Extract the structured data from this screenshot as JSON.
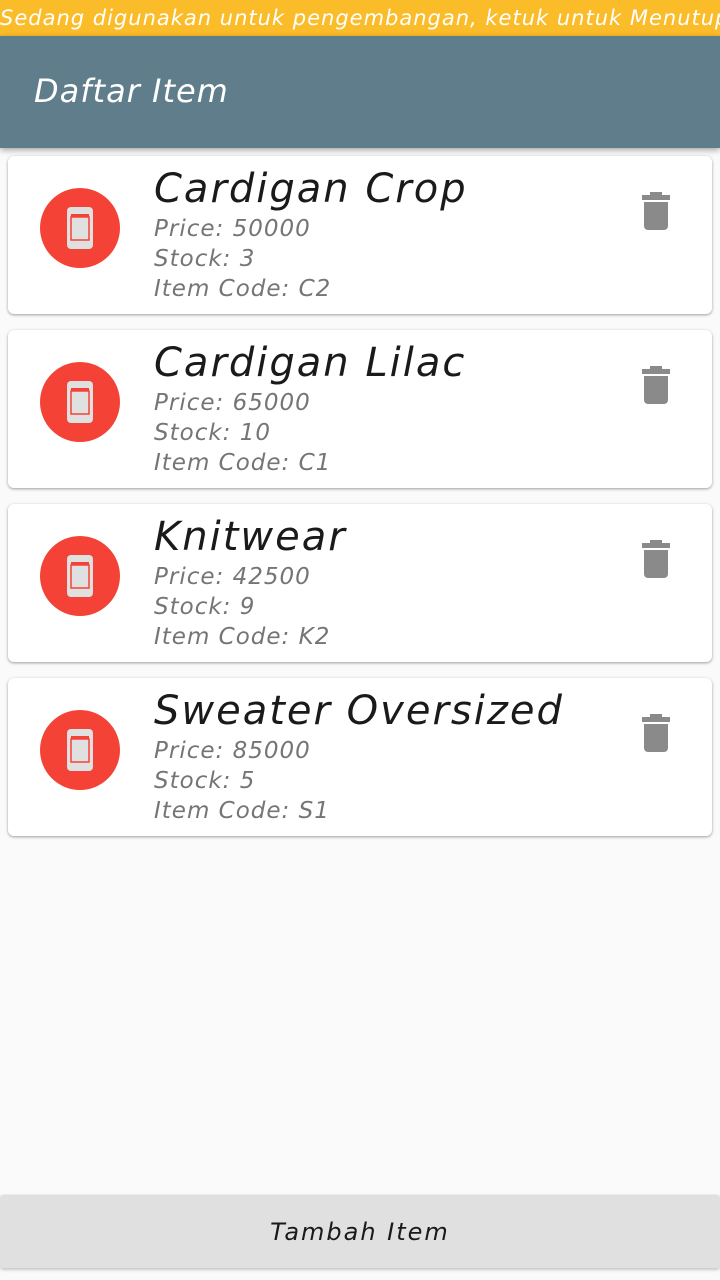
{
  "dev_banner": {
    "text": "Sedang digunakan untuk pengembangan, ketuk untuk Menutup"
  },
  "app_bar": {
    "title": "Daftar Item",
    "color": "#607d8b"
  },
  "accent_colors": {
    "avatar": "#f44336",
    "banner": "#fbbc2a",
    "delete_icon": "#8a8a8a"
  },
  "items": [
    {
      "name": "Cardigan Crop",
      "price": "Price: 50000",
      "stock": "Stock: 3",
      "code": "Item Code: C2",
      "icon": "phone-icon",
      "action_icon": "trash-icon"
    },
    {
      "name": "Cardigan Lilac",
      "price": "Price: 65000",
      "stock": "Stock: 10",
      "code": "Item Code: C1",
      "icon": "phone-icon",
      "action_icon": "trash-icon"
    },
    {
      "name": "Knitwear",
      "price": "Price: 42500",
      "stock": "Stock: 9",
      "code": "Item Code: K2",
      "icon": "phone-icon",
      "action_icon": "trash-icon"
    },
    {
      "name": "Sweater Oversized",
      "price": "Price: 85000",
      "stock": "Stock: 5",
      "code": "Item Code: S1",
      "icon": "phone-icon",
      "action_icon": "trash-icon"
    }
  ],
  "bottom_button": {
    "label": "Tambah Item"
  }
}
